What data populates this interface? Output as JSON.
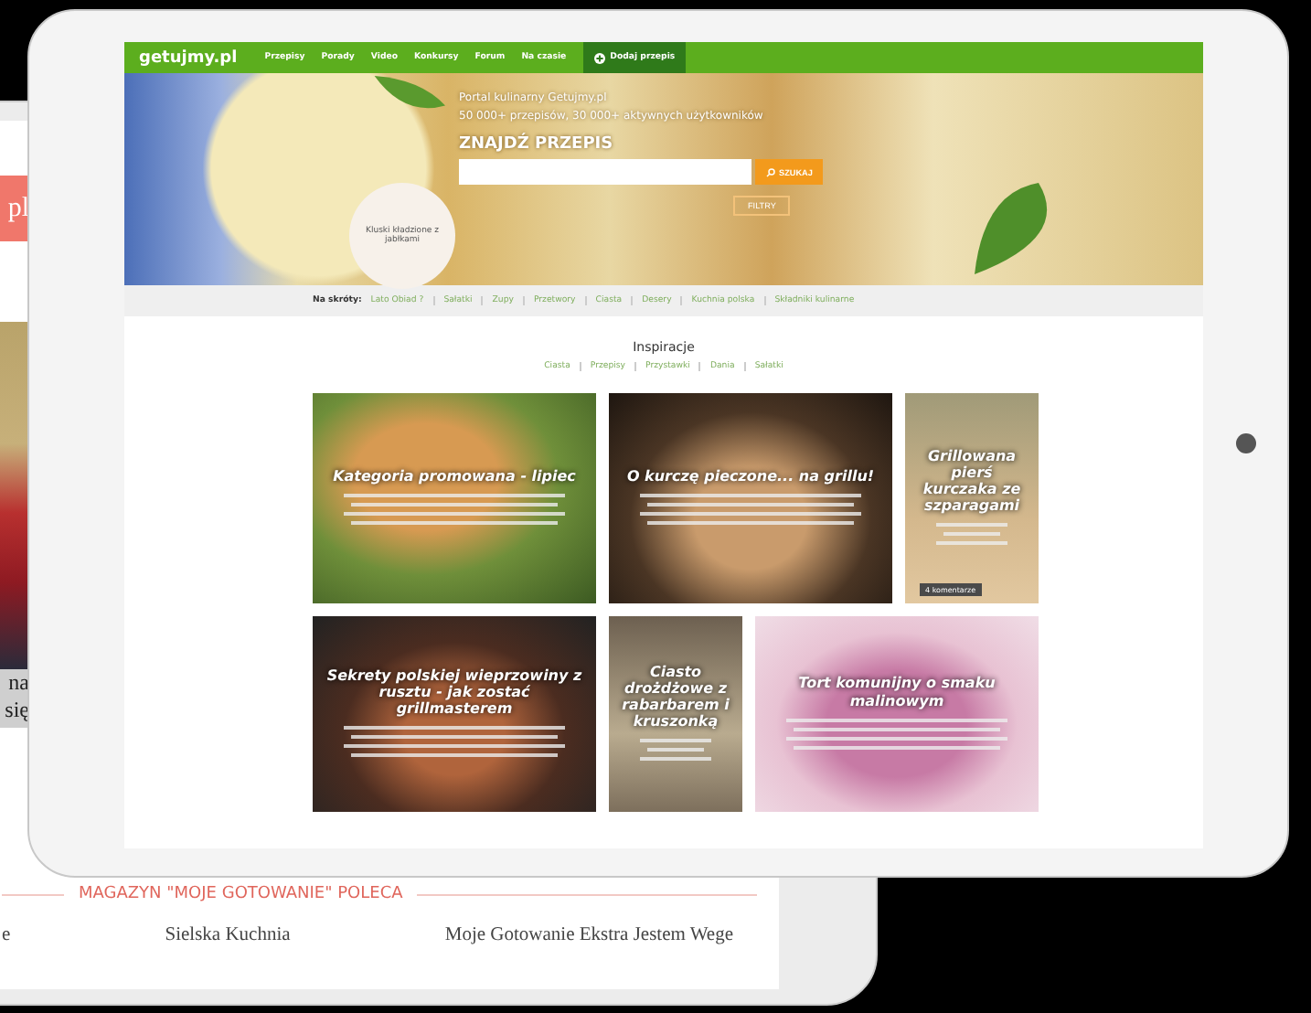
{
  "back_tablet": {
    "header_text": "pl",
    "caption_lines": [
      "na",
      "się"
    ],
    "section_title": "MAGAZYN \"MOJE GOTOWANIE\" POLECA",
    "magazines": [
      "e",
      "Sielska Kuchnia",
      "Moje Gotowanie Ekstra Jestem Wege"
    ]
  },
  "front_tablet": {
    "logo": "getujmy.pl",
    "nav": [
      {
        "label": "Przepisy",
        "kind": "link"
      },
      {
        "label": "Porady",
        "kind": "link"
      },
      {
        "label": "Video",
        "kind": "link"
      },
      {
        "label": "Konkursy",
        "kind": "link"
      },
      {
        "label": "Forum",
        "kind": "link"
      },
      {
        "label": "Na czasie",
        "kind": "link"
      },
      {
        "label": "Dodaj przepis",
        "kind": "action"
      }
    ],
    "hero": {
      "tagline": "Portal kulinarny Getujmy.pl",
      "stats": "50 000+ przepisów, 30 000+ aktywnych użytkowników",
      "heading": "ZNAJDŹ PRZEPIS",
      "search_button": "SZUKAJ",
      "filter_button": "FILTRY",
      "badge": "Kluski kładzione z jabłkami"
    },
    "shortcuts": {
      "label": "Na skróty:",
      "links": [
        "Lato Obiad ?",
        "Sałatki",
        "Zupy",
        "Przetwory",
        "Ciasta",
        "Desery",
        "Kuchnia polska",
        "Składniki kulinarne"
      ]
    },
    "inspiration": {
      "title": "Inspiracje",
      "links": [
        "Ciasta",
        "Przepisy",
        "Przystawki",
        "Dania",
        "Sałatki"
      ]
    },
    "cards": [
      {
        "title": "Kategoria promowana - lipiec",
        "kind": "wide"
      },
      {
        "title": "O kurczę pieczone... na grillu!",
        "kind": "wide"
      },
      {
        "title": "Grillowana pierś kurczaka ze szparagami",
        "kind": "narrow",
        "badge": "4 komentarze"
      },
      {
        "title": "Sekrety polskiej wieprzowiny z rusztu - jak zostać grillmasterem",
        "kind": "wide"
      },
      {
        "title": "Ciasto drożdżowe z rabarbarem i kruszonką",
        "kind": "narrow"
      },
      {
        "title": "Tort komunijny o smaku malinowym",
        "kind": "wide"
      }
    ]
  }
}
